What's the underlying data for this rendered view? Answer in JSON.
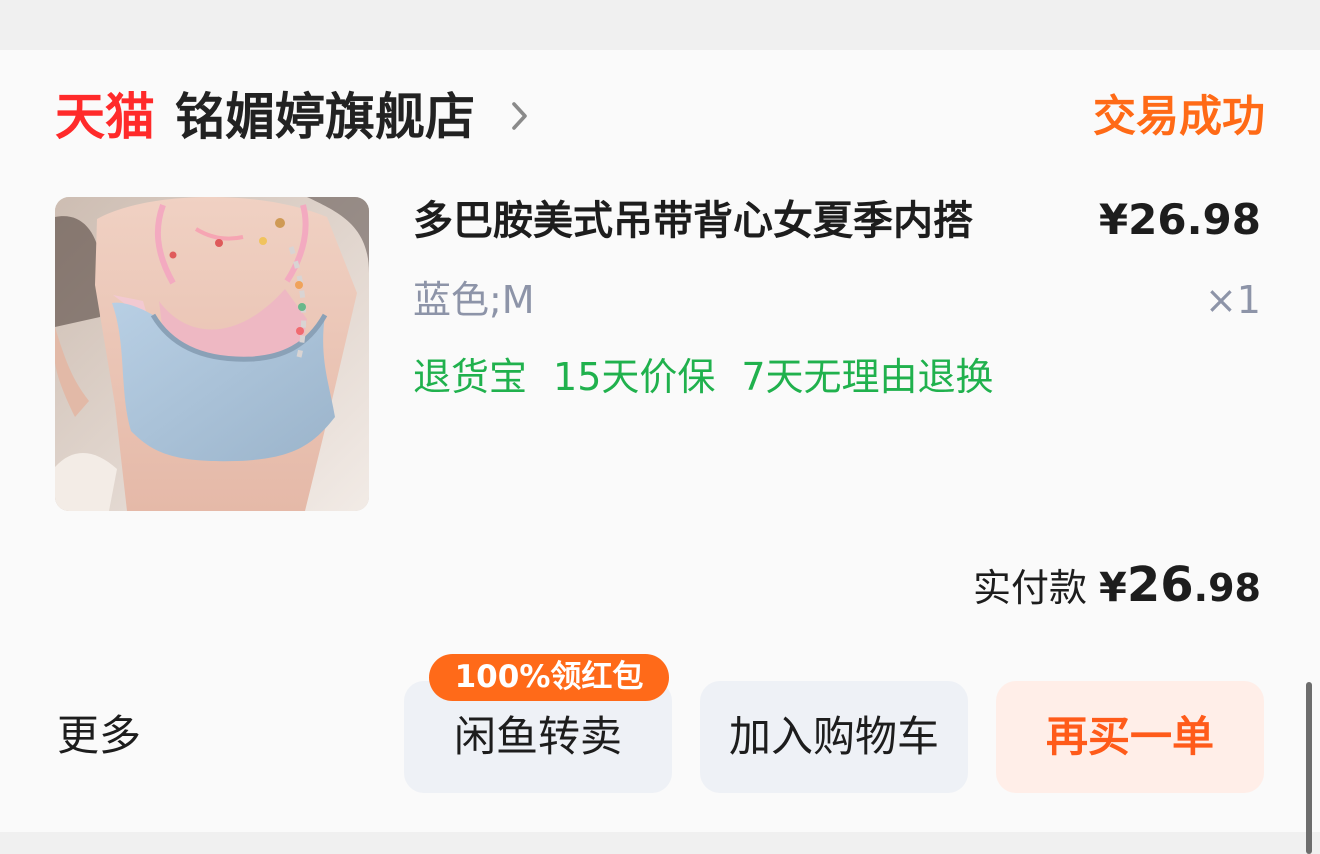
{
  "shop": {
    "brand": "天猫",
    "name": "铭媚婷旗舰店",
    "status": "交易成功",
    "colors": {
      "brand": "#ff2a2a",
      "status": "#ff6a16"
    }
  },
  "product": {
    "title": "多巴胺美式吊带背心女夏季内搭",
    "price": "¥26.98",
    "spec": "蓝色;M",
    "quantity": "×1",
    "tags": [
      "退货宝",
      "15天价保",
      "7天无理由退换"
    ]
  },
  "payment": {
    "label": "实付款",
    "currency": "¥",
    "whole": "26",
    "decimal": ".98"
  },
  "actions": {
    "more": "更多",
    "badge": "100%领红包",
    "buttons": [
      "闲鱼转卖",
      "加入购物车",
      "再买一单"
    ]
  },
  "icons": {
    "chevron": "chevron-right-icon"
  }
}
